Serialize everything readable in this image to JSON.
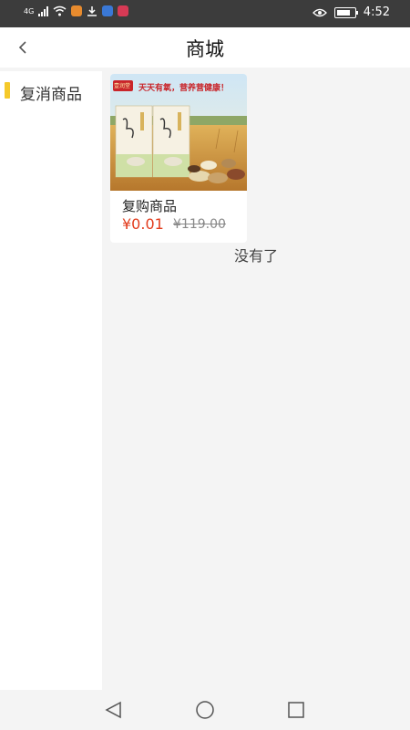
{
  "status_bar": {
    "carrier_tag": "4G",
    "time": "4:52"
  },
  "header": {
    "title": "商城"
  },
  "sidebar": {
    "items": [
      {
        "label": "复消商品",
        "active": true
      }
    ]
  },
  "product": {
    "name": "复购商品",
    "price": "¥0.01",
    "original_price": "¥119.00",
    "banner_logo": "壹润堂",
    "banner_slogan": "天天有氧，营养营健康！"
  },
  "list_end_text": "没有了",
  "colors": {
    "accent": "#f5c92a",
    "price": "#e23b1c",
    "header_bg": "#ffffff",
    "page_bg": "#f4f4f4",
    "status_bar_bg": "#3c3c3c"
  },
  "icons": [
    "signal-icon",
    "wifi-icon",
    "download-icon",
    "eye-icon",
    "battery-icon",
    "back-icon",
    "nav-back-icon",
    "nav-home-icon",
    "nav-recents-icon"
  ]
}
